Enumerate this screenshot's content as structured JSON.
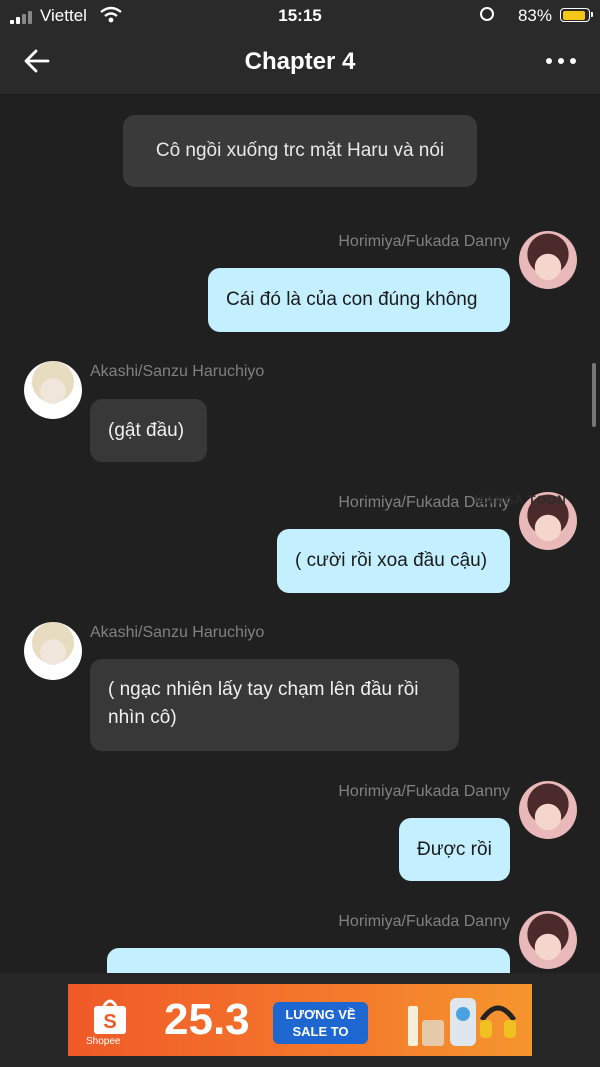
{
  "status_bar": {
    "carrier": "Viettel",
    "time": "15:15",
    "battery": "83%"
  },
  "header": {
    "title": "Chapter 4"
  },
  "messages": [
    {
      "type": "narration",
      "text": "Cô ngồi xuống trc mặt Haru và nói"
    },
    {
      "type": "right",
      "name": "Horimiya/Fukada Danny",
      "text": "Cái đó là của con đúng không"
    },
    {
      "type": "left",
      "name": "Akashi/Sanzu Haruchiyo",
      "text": "(gật đầu)"
    },
    {
      "type": "right",
      "name": "Horimiya/Fukada Danny",
      "text": "( cười rồi xoa đầu cậu)"
    },
    {
      "type": "left",
      "name": "Akashi/Sanzu Haruchiyo",
      "text": "( ngạc nhiên lấy tay chạm lên đầu rồi nhìn cô)"
    },
    {
      "type": "right",
      "name": "Horimiya/Fukada Danny",
      "text": "Được rồi"
    },
    {
      "type": "right",
      "name": "Horimiya/Fukada Danny",
      "text": ""
    }
  ],
  "ad": {
    "brand": "Shopee",
    "promo": "25.3",
    "tag_line1": "LƯƠNG VỀ",
    "tag_line2": "SALE TO"
  },
  "colors": {
    "background": "#202020",
    "bubble_right": "#c4efff",
    "bubble_left": "#383838",
    "banner": "#f05a28"
  }
}
